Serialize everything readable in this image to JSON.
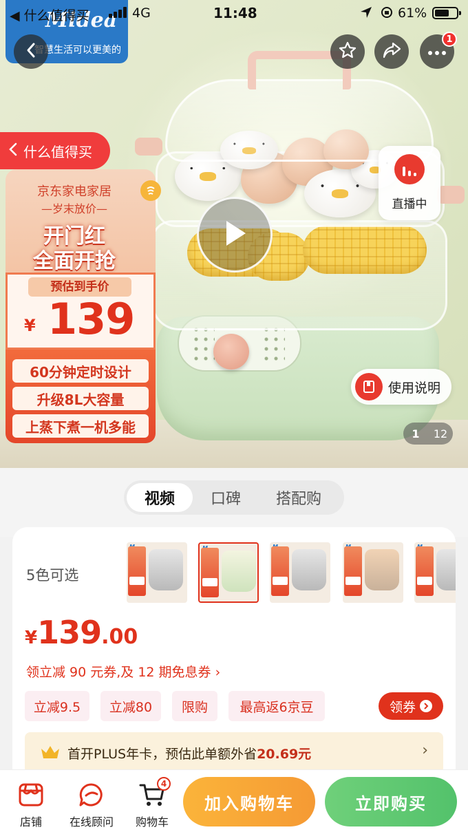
{
  "status_bar": {
    "back_app": "◀ 什么值得买",
    "network": "4G",
    "time": "11:48",
    "battery": "61%"
  },
  "brand": {
    "logo": "Midea",
    "slogan": "智慧生活可以更美的"
  },
  "nav": {
    "more_badge": "1"
  },
  "hero": {
    "source_tag": "什么值得买",
    "promo": {
      "line1": "京东家电家居",
      "line2": "—岁末放价—",
      "line3": "开门红",
      "line4": "全面开抢",
      "coin": "hui",
      "price_label": "预估到手价",
      "price_symbol": "¥",
      "price": "139",
      "features": [
        "60分钟定时设计",
        "升级8L大容量",
        "上蒸下煮一机多能"
      ]
    },
    "live_label": "直播中",
    "manual_label": "使用说明",
    "page_current": "1",
    "page_total": "12"
  },
  "tabs": [
    {
      "label": "视频",
      "active": true
    },
    {
      "label": "口碑",
      "active": false
    },
    {
      "label": "搭配购",
      "active": false
    }
  ],
  "product": {
    "colors_label": "5色可选",
    "price_symbol": "¥",
    "price_int": "139",
    "price_dec": ".00",
    "coupon_line": "领立减 90 元券,及 12 期免息券 ›",
    "tags": [
      "立减9.5",
      "立减80",
      "限购",
      "最高返6京豆"
    ],
    "get_coupon": "领券",
    "plus_text_prefix": "首开PLUS年卡，预估此单额外省",
    "plus_save": "20.69元",
    "plus_arrow": "›"
  },
  "bottom_bar": {
    "shop": "店铺",
    "consult": "在线顾问",
    "cart": "购物车",
    "cart_count": "4",
    "add_to_cart": "加入购物车",
    "buy_now": "立即购买"
  },
  "colors": {
    "accent_red": "#e0321c",
    "cart_orange": "#f59a34",
    "buy_green": "#53c26b"
  }
}
